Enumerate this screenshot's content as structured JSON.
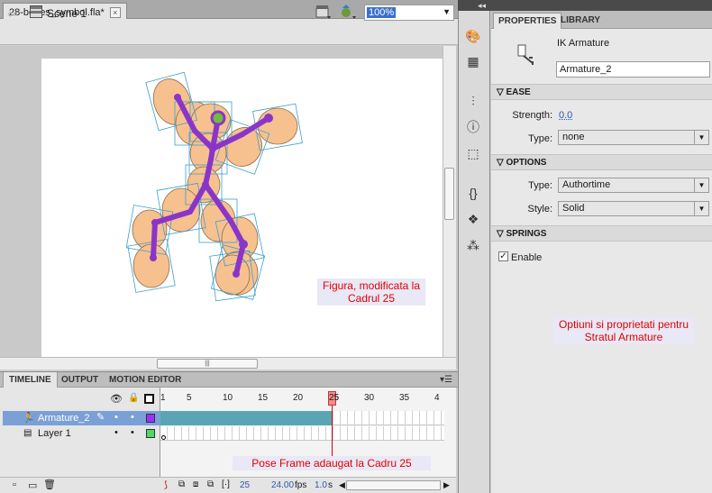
{
  "document": {
    "tab_title": "28-bones_symbol.fla*",
    "tab_close": "×",
    "scene_label": "Scene 1",
    "zoom_value": "100%",
    "scroll_grip": "|||"
  },
  "stage_notes": {
    "figure_note": "Figura, modificata la Cadrul 25",
    "options_note": "Optiuni si proprietati pentru Stratul Armature",
    "pose_note": "Pose Frame adaugat la Cadru 25"
  },
  "timeline": {
    "tabs": [
      "TIMELINE",
      "OUTPUT",
      "MOTION EDITOR"
    ],
    "panel_menu": "▾☰",
    "ruler_ticks": [
      "1",
      "5",
      "10",
      "15",
      "20",
      "25",
      "30",
      "35",
      "4"
    ],
    "layers": [
      {
        "name": "Armature_2",
        "selected": true,
        "color": "#9b30ff"
      },
      {
        "name": "Layer 1",
        "selected": false,
        "color": "#4cd964"
      }
    ],
    "status": {
      "frame": "25",
      "fps": "24.00",
      "fps_unit": "fps",
      "time": "1.0",
      "time_unit": "s"
    }
  },
  "panel_collapse": "◂◂",
  "properties": {
    "tabs": [
      "PROPERTIES",
      "LIBRARY"
    ],
    "type_label": "IK Armature",
    "instance_name": "Armature_2",
    "sections": {
      "ease": "EASE",
      "options": "OPTIONS",
      "springs": "SPRINGS"
    },
    "ease": {
      "strength_label": "Strength:",
      "strength_value": "0.0",
      "type_label": "Type:",
      "type_value": "none"
    },
    "options": {
      "type_label": "Type:",
      "type_value": "Authortime",
      "style_label": "Style:",
      "style_value": "Solid"
    },
    "springs": {
      "enable_label": "Enable",
      "enable_checked": true
    }
  },
  "colors": {
    "bone": "#8a35c9",
    "shape_fill": "#f7c08f",
    "bbox": "#3aa0d0",
    "note_text": "#e00000",
    "note_bg": "#e8e8f6",
    "armature_span": "#5aa5b5"
  }
}
